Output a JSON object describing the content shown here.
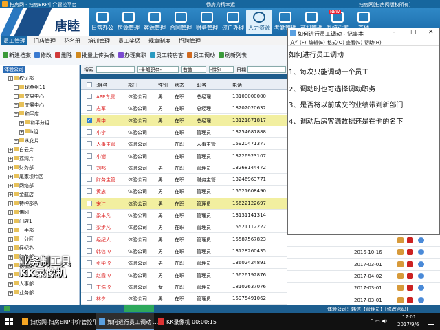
{
  "app": {
    "title_left": "扫房网 - 扫房ERP中介管控平台",
    "title_center": "畅房力精幸运",
    "title_right": "扫房网[扫房网版权所有]",
    "logo_text": "唐睦"
  },
  "nav": [
    "日常办公",
    "房源管理",
    "客源管理",
    "合同管理",
    "财务管理",
    "过户办理",
    "人力资源",
    "考勤管理",
    "商机管理",
    "系统设置",
    "其他"
  ],
  "nav_badge": "NEW",
  "tabs": [
    "员工管理",
    "门店管理",
    "花名册",
    "培训管理",
    "员工奖惩",
    "规章制度",
    "招聘管理"
  ],
  "toolbar": [
    "新建档案",
    "修改",
    "删除",
    "批量上传头像",
    "办理离职",
    "员工转房客",
    "员工调动",
    "刷新列表"
  ],
  "tree": [
    {
      "label": "体验公司",
      "level": 0,
      "selected": true
    },
    {
      "label": "权证部",
      "level": 1
    },
    {
      "label": "现金组11",
      "level": 2
    },
    {
      "label": "交易中心",
      "level": 2
    },
    {
      "label": "交易中心",
      "level": 2
    },
    {
      "label": "和平店",
      "level": 2
    },
    {
      "label": "和平分组",
      "level": 3
    },
    {
      "label": "b组",
      "level": 3
    },
    {
      "label": "从化片",
      "level": 2
    },
    {
      "label": "白云片",
      "level": 1
    },
    {
      "label": "荔湾片",
      "level": 1
    },
    {
      "label": "财务部",
      "level": 1
    },
    {
      "label": "尾家坝片区",
      "level": 1
    },
    {
      "label": "网络部",
      "level": 1
    },
    {
      "label": "金航店",
      "level": 1
    },
    {
      "label": "特种部队",
      "level": 1
    },
    {
      "label": "佛冈",
      "level": 1
    },
    {
      "label": "门店1",
      "level": 1
    },
    {
      "label": "一手部",
      "level": 1
    },
    {
      "label": "一分区",
      "level": 1
    },
    {
      "label": "经纪办",
      "level": 1
    },
    {
      "label": "财务部",
      "level": 1
    },
    {
      "label": "权证部",
      "level": 1
    },
    {
      "label": "后勤部",
      "level": 1
    },
    {
      "label": "人事部",
      "level": 1
    },
    {
      "label": "业务部",
      "level": 1
    }
  ],
  "filter": {
    "search_label": "搜索",
    "dept_value": "-全部职务-",
    "status_value": "有效",
    "gender_value": "-性别",
    "date_label": "日期"
  },
  "columns": [
    "",
    ":姓名",
    "部门",
    "性别",
    "状态",
    "职务",
    "电话"
  ],
  "rows": [
    {
      "name": "APP专属",
      "dept": "体验公司",
      "gender": "男",
      "status": "在职",
      "title": "总经理",
      "phone": "18100000000",
      "checked": false,
      "hl": false,
      "red": true
    },
    {
      "name": "志军",
      "dept": "体验公司",
      "gender": "男",
      "status": "在职",
      "title": "总经理",
      "phone": "18202020632",
      "checked": false,
      "hl": false,
      "red": true
    },
    {
      "name": "周申",
      "dept": "体验公司",
      "gender": "男",
      "status": "在职",
      "title": "总经理",
      "phone": "13121871817",
      "checked": true,
      "hl": true,
      "red": true
    },
    {
      "name": "小李",
      "dept": "体验公司",
      "gender": "",
      "status": "在职",
      "title": "管理员",
      "phone": "13254687888",
      "checked": false,
      "hl": false,
      "red": true
    },
    {
      "name": "人事主管",
      "dept": "体验公司",
      "gender": "",
      "status": "在职",
      "title": "人事主管",
      "phone": "15920471377",
      "checked": false,
      "hl": false,
      "red": true
    },
    {
      "name": "小谢",
      "dept": "体验公司",
      "gender": "",
      "status": "在职",
      "title": "管理员",
      "phone": "13226923107",
      "checked": false,
      "hl": false,
      "red": true
    },
    {
      "name": "刘邦",
      "dept": "体验公司",
      "gender": "男",
      "status": "在职",
      "title": "管理员",
      "phone": "13268144472",
      "checked": false,
      "hl": false,
      "red": true
    },
    {
      "name": "财务主管",
      "dept": "体验公司",
      "gender": "男",
      "status": "在职",
      "title": "财务主管",
      "phone": "13246963771",
      "checked": false,
      "hl": false,
      "red": true
    },
    {
      "name": "黄忠",
      "dept": "体验公司",
      "gender": "男",
      "status": "在职",
      "title": "管理员",
      "phone": "15521608490",
      "checked": false,
      "hl": false,
      "red": true
    },
    {
      "name": "宋江",
      "dept": "体验公司",
      "gender": "男",
      "status": "在职",
      "title": "管理员",
      "phone": "15622122697",
      "checked": false,
      "hl": true,
      "red": true
    },
    {
      "name": "梁丰凡",
      "dept": "体验公司",
      "gender": "男",
      "status": "在职",
      "title": "管理员",
      "phone": "13131141314",
      "checked": false,
      "hl": false,
      "red": true
    },
    {
      "name": "梁步凡",
      "dept": "体验公司",
      "gender": "男",
      "status": "在职",
      "title": "管理员",
      "phone": "15521112222",
      "checked": false,
      "hl": false,
      "red": true
    },
    {
      "name": "经纪人",
      "dept": "体验公司",
      "gender": "男",
      "status": "在职",
      "title": "管理员",
      "phone": "15587567823",
      "checked": false,
      "hl": false,
      "red": true
    },
    {
      "name": "韩信 ♀",
      "dept": "体验公司",
      "gender": "男",
      "status": "在职",
      "title": "管理员",
      "phone": "13128260435",
      "checked": false,
      "hl": false,
      "red": true
    },
    {
      "name": "张华 ♀",
      "dept": "体验公司",
      "gender": "男",
      "status": "在职",
      "title": "管理员",
      "phone": "13602424891",
      "checked": false,
      "hl": false,
      "red": true
    },
    {
      "name": "赵霞 ♀",
      "dept": "体验公司",
      "gender": "男",
      "status": "在职",
      "title": "管理员",
      "phone": "15626192876",
      "checked": false,
      "hl": false,
      "red": true
    },
    {
      "name": "丁浩 ♀",
      "dept": "体验公司",
      "gender": "女",
      "status": "在职",
      "title": "管理员",
      "phone": "18102637076",
      "checked": false,
      "hl": false,
      "red": true
    },
    {
      "name": "林夕",
      "dept": "体验公司",
      "gender": "男",
      "status": "在职",
      "title": "管理员",
      "phone": "15975491062",
      "checked": false,
      "hl": false,
      "red": true
    }
  ],
  "right_dates": [
    "",
    "2016-10-16",
    "2017-03-01",
    "2017-04-02",
    "2017-03-01",
    "2017-03-01"
  ],
  "status_bar": {
    "user": "体验公司：韩信【管理员】[修改密码]"
  },
  "notepad": {
    "title": "如何进行员工调动 - 记事本",
    "menu": [
      "文件(F)",
      "编辑(E)",
      "格式(O)",
      "查看(V)",
      "帮助(H)"
    ],
    "lines": [
      "如何进行员工调动",
      "1、每次只能调动一个员工",
      "2、调动时也可选择调动职务",
      "3、是否将以前成交的业绩带到新部门",
      "4、调动后房客源数据还是在他的名下"
    ]
  },
  "taskbar": {
    "tasks": [
      "扫房网-扫房ERP中介管控平台",
      "如何进行员工调动 ...",
      "KK录像机 00:00:15"
    ],
    "time": "17:01",
    "date": "2017/9/6"
  },
  "watermark": [
    "业务制工具",
    "KK录像机"
  ]
}
